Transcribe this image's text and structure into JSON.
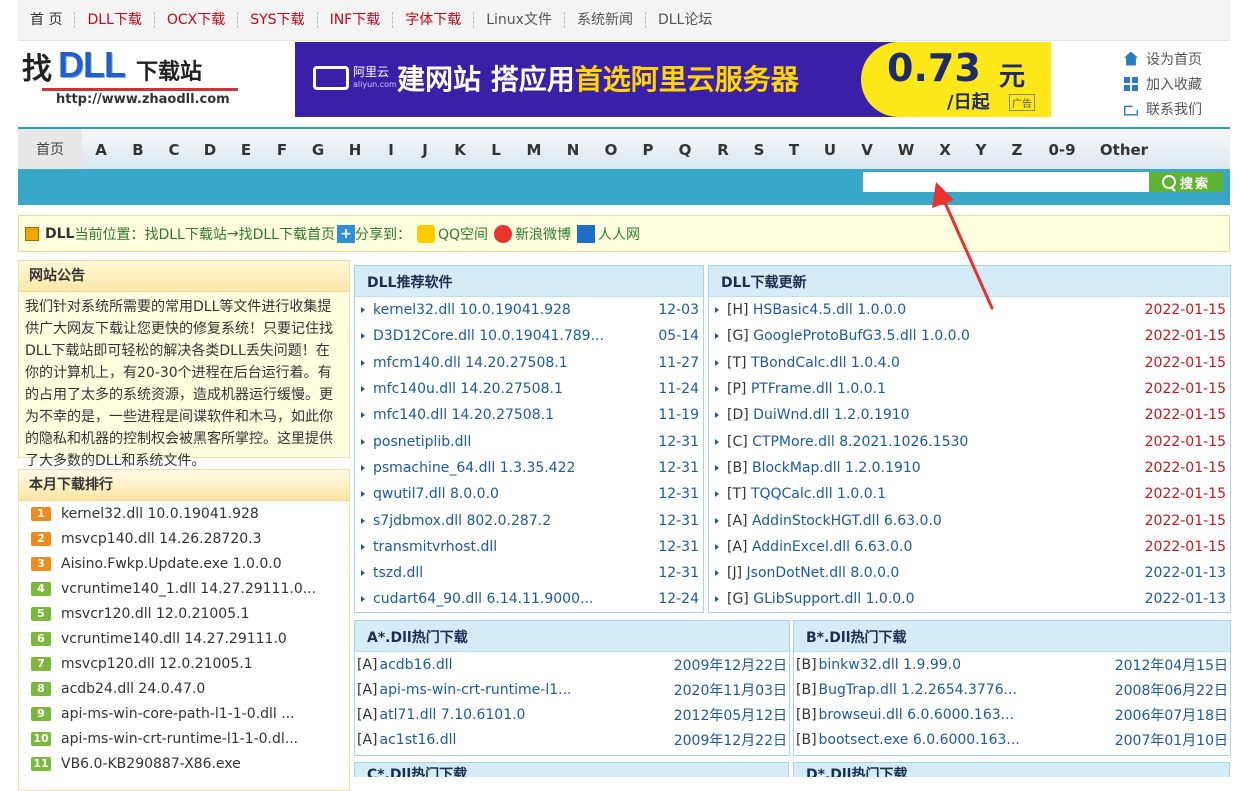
{
  "topnav": [
    {
      "label": "首 页",
      "color": "#333333"
    },
    {
      "label": "DLL下载",
      "color": "#d0021b"
    },
    {
      "label": "OCX下载",
      "color": "#d0021b"
    },
    {
      "label": "SYS下载",
      "color": "#d0021b"
    },
    {
      "label": "INF下载",
      "color": "#d0021b"
    },
    {
      "label": "字体下载",
      "color": "#d0021b"
    },
    {
      "label": "Linux文件",
      "color": "#555555"
    },
    {
      "label": "系统新闻",
      "color": "#555555"
    },
    {
      "label": "DLL论坛",
      "color": "#555555"
    }
  ],
  "logo": {
    "part1": "找",
    "part2": "DLL",
    "part3": "下载站",
    "url": "http://www.zhaodll.com"
  },
  "banner": {
    "brand": "阿里云",
    "brand_sub": "aliyun.com",
    "title_white": "建网站 搭应用",
    "title_yellow": "首选阿里云服务器",
    "price": "0.73",
    "unit": "元",
    "per": "/日起",
    "ad": "广告"
  },
  "right_links": {
    "set_home": "设为首页",
    "add_fav": "加入收藏",
    "contact": "联系我们"
  },
  "letters": [
    "首页",
    "A",
    "B",
    "C",
    "D",
    "E",
    "F",
    "G",
    "H",
    "I",
    "J",
    "K",
    "L",
    "M",
    "N",
    "O",
    "P",
    "Q",
    "R",
    "S",
    "T",
    "U",
    "V",
    "W",
    "X",
    "Y",
    "Z",
    "0-9",
    "Other"
  ],
  "search": {
    "placeholder": "",
    "button": "搜索"
  },
  "breadcrumb": {
    "prefix": "DLL",
    "label": "当前位置：",
    "site": "找DLL下载站",
    "sep": " → ",
    "page": "找DLL下载首页",
    "share": "分享到：",
    "qq": "QQ空间",
    "weibo": "新浪微博",
    "renren": "人人网"
  },
  "notice": {
    "title": "网站公告",
    "text": "我们针对系统所需要的常用DLL等文件进行收集提供广大网友下载让您更快的修复系统！只要记住找DLL下载站即可轻松的解决各类DLL丢失问题！在你的计算机上，有20-30个进程在后台运行着。有的占用了太多的系统资源，造成机器运行缓慢。更为不幸的是，一些进程是间谍软件和木马，如此你的隐私和机器的控制权会被黑客所掌控。这里提供了大多数的DLL和系统文件。"
  },
  "rank": {
    "title": "本月下载排行",
    "items": [
      {
        "num": "1",
        "name": "kernel32.dll 10.0.19041.928"
      },
      {
        "num": "2",
        "name": "msvcp140.dll 14.26.28720.3"
      },
      {
        "num": "3",
        "name": "Aisino.Fwkp.Update.exe 1.0.0.0"
      },
      {
        "num": "4",
        "name": "vcruntime140_1.dll 14.27.29111.0..."
      },
      {
        "num": "5",
        "name": "msvcr120.dll 12.0.21005.1"
      },
      {
        "num": "6",
        "name": "vcruntime140.dll 14.27.29111.0"
      },
      {
        "num": "7",
        "name": "msvcp120.dll 12.0.21005.1"
      },
      {
        "num": "8",
        "name": "acdb24.dll 24.0.47.0"
      },
      {
        "num": "9",
        "name": "api-ms-win-core-path-l1-1-0.dll ..."
      },
      {
        "num": "10",
        "name": "api-ms-win-crt-runtime-l1-1-0.dl..."
      },
      {
        "num": "11",
        "name": "VB6.0-KB290887-X86.exe"
      }
    ]
  },
  "recommend": {
    "title": "DLL推荐软件",
    "items": [
      {
        "name": "kernel32.dll 10.0.19041.928",
        "date": "12-03"
      },
      {
        "name": "D3D12Core.dll 10.0.19041.789...",
        "date": "05-14"
      },
      {
        "name": "mfcm140.dll 14.20.27508.1",
        "date": "11-27"
      },
      {
        "name": "mfc140u.dll 14.20.27508.1",
        "date": "11-24"
      },
      {
        "name": "mfc140.dll 14.20.27508.1",
        "date": "11-19"
      },
      {
        "name": "posnetiplib.dll",
        "date": "12-31"
      },
      {
        "name": "psmachine_64.dll 1.3.35.422",
        "date": "12-31"
      },
      {
        "name": "qwutil7.dll 8.0.0.0",
        "date": "12-31"
      },
      {
        "name": "s7jdbmox.dll 802.0.287.2",
        "date": "12-31"
      },
      {
        "name": "transmitvrhost.dll",
        "date": "12-31"
      },
      {
        "name": "tszd.dll",
        "date": "12-31"
      },
      {
        "name": "cudart64_90.dll 6.14.11.9000...",
        "date": "12-24"
      }
    ]
  },
  "updates": {
    "title": "DLL下载更新",
    "items": [
      {
        "cat": "[H]",
        "name": "HSBasic4.5.dll 1.0.0.0",
        "date": "2022-01-15",
        "color": "#c4161c"
      },
      {
        "cat": "[G]",
        "name": "GoogleProtoBufG3.5.dll 1.0.0.0",
        "date": "2022-01-15",
        "color": "#c4161c"
      },
      {
        "cat": "[T]",
        "name": "TBondCalc.dll 1.0.4.0",
        "date": "2022-01-15",
        "color": "#c4161c"
      },
      {
        "cat": "[P]",
        "name": "PTFrame.dll 1.0.0.1",
        "date": "2022-01-15",
        "color": "#c4161c"
      },
      {
        "cat": "[D]",
        "name": "DuiWnd.dll 1.2.0.1910",
        "date": "2022-01-15",
        "color": "#c4161c"
      },
      {
        "cat": "[C]",
        "name": "CTPMore.dll 8.2021.1026.1530",
        "date": "2022-01-15",
        "color": "#c4161c"
      },
      {
        "cat": "[B]",
        "name": "BlockMap.dll 1.2.0.1910",
        "date": "2022-01-15",
        "color": "#c4161c"
      },
      {
        "cat": "[T]",
        "name": "TQQCalc.dll 1.0.0.1",
        "date": "2022-01-15",
        "color": "#c4161c"
      },
      {
        "cat": "[A]",
        "name": "AddinStockHGT.dll 6.63.0.0",
        "date": "2022-01-15",
        "color": "#c4161c"
      },
      {
        "cat": "[A]",
        "name": "AddinExcel.dll 6.63.0.0",
        "date": "2022-01-15",
        "color": "#c4161c"
      },
      {
        "cat": "[J]",
        "name": "JsonDotNet.dll 8.0.0.0",
        "date": "2022-01-13",
        "color": "#1a5aa4"
      },
      {
        "cat": "[G]",
        "name": "GLibSupport.dll 1.0.0.0",
        "date": "2022-01-13",
        "color": "#1a5aa4"
      }
    ]
  },
  "hotA": {
    "title": "A*.Dll热门下载",
    "items": [
      {
        "cat": "[A]",
        "name": "acdb16.dll",
        "date": "2009年12月22日"
      },
      {
        "cat": "[A]",
        "name": "api-ms-win-crt-runtime-l1...",
        "date": "2020年11月03日"
      },
      {
        "cat": "[A]",
        "name": "atl71.dll 7.10.6101.0",
        "date": "2012年05月12日"
      },
      {
        "cat": "[A]",
        "name": "ac1st16.dll",
        "date": "2009年12月22日"
      }
    ]
  },
  "hotB": {
    "title": "B*.Dll热门下载",
    "items": [
      {
        "cat": "[B]",
        "name": "binkw32.dll 1.9.99.0",
        "date": "2012年04月15日"
      },
      {
        "cat": "[B]",
        "name": "BugTrap.dll 1.2.2654.3776...",
        "date": "2008年06月22日"
      },
      {
        "cat": "[B]",
        "name": "browseui.dll 6.0.6000.163...",
        "date": "2006年07月18日"
      },
      {
        "cat": "[B]",
        "name": "bootsect.exe 6.0.6000.163...",
        "date": "2007年01月10日"
      }
    ]
  },
  "stubs": {
    "c": "C*.Dll热门下载",
    "d": "D*.Dll热门下载"
  },
  "colors": {
    "accent": "#39a7c9",
    "link": "#1a5aa4",
    "red": "#c4161c",
    "annotation": "#e8322b"
  }
}
